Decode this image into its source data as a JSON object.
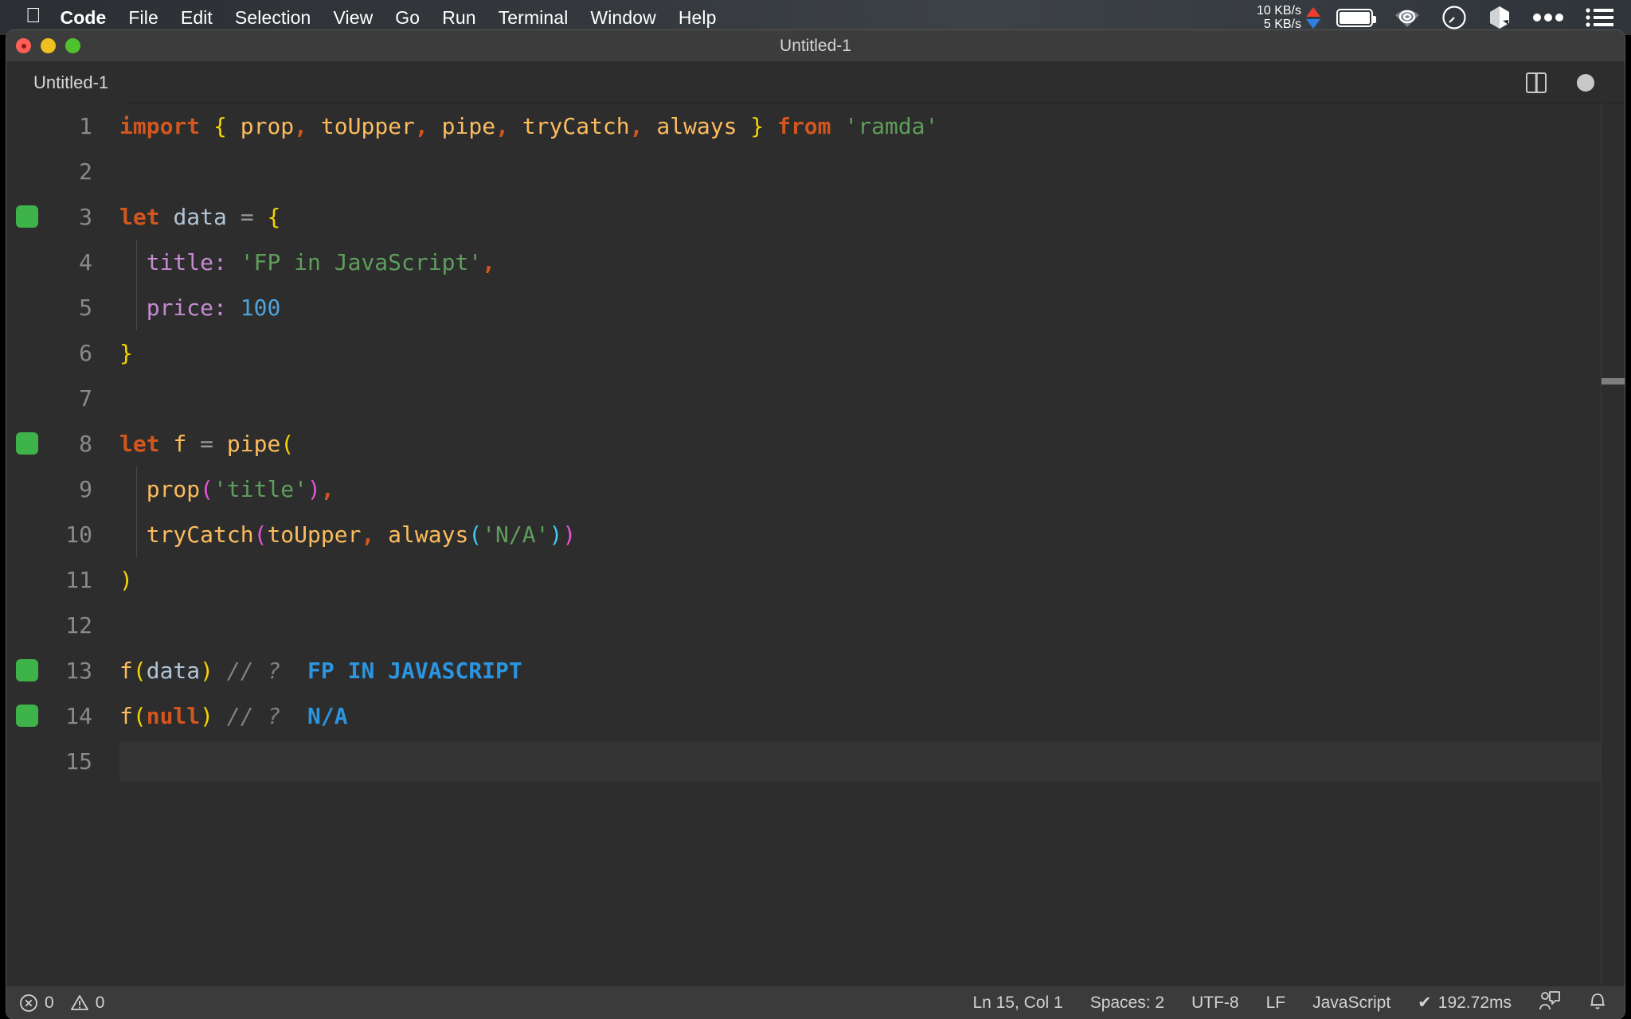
{
  "menubar": {
    "apple_icon": "apple-logo-icon",
    "items": [
      {
        "label": "Code",
        "bold": true
      },
      {
        "label": "File",
        "bold": false
      },
      {
        "label": "Edit",
        "bold": false
      },
      {
        "label": "Selection",
        "bold": false
      },
      {
        "label": "View",
        "bold": false
      },
      {
        "label": "Go",
        "bold": false
      },
      {
        "label": "Run",
        "bold": false
      },
      {
        "label": "Terminal",
        "bold": false
      },
      {
        "label": "Window",
        "bold": false
      },
      {
        "label": "Help",
        "bold": false
      }
    ],
    "network": {
      "upload": "10 KB/s",
      "download": "5 KB/s",
      "upload_color": "#ef3b2d",
      "download_color": "#2f7fe0"
    },
    "status_icons": [
      "battery-icon",
      "wifi-icon",
      "speedometer-icon",
      "box-icon",
      "ellipsis-icon",
      "list-icon"
    ]
  },
  "window": {
    "title": "Untitled-1"
  },
  "tabbar": {
    "tab_label": "Untitled-1",
    "actions": [
      "split-editor-icon",
      "unsaved-dot-icon"
    ]
  },
  "editor": {
    "language": "JavaScript",
    "active_line": 15,
    "lines": [
      {
        "n": "1",
        "badge": false,
        "indent": false
      },
      {
        "n": "2",
        "badge": false,
        "indent": false
      },
      {
        "n": "3",
        "badge": true,
        "indent": false
      },
      {
        "n": "4",
        "badge": false,
        "indent": true
      },
      {
        "n": "5",
        "badge": false,
        "indent": true
      },
      {
        "n": "6",
        "badge": false,
        "indent": false
      },
      {
        "n": "7",
        "badge": false,
        "indent": false
      },
      {
        "n": "8",
        "badge": true,
        "indent": false
      },
      {
        "n": "9",
        "badge": false,
        "indent": true
      },
      {
        "n": "10",
        "badge": false,
        "indent": true
      },
      {
        "n": "11",
        "badge": false,
        "indent": false
      },
      {
        "n": "12",
        "badge": false,
        "indent": false
      },
      {
        "n": "13",
        "badge": true,
        "indent": false
      },
      {
        "n": "14",
        "badge": true,
        "indent": false
      },
      {
        "n": "15",
        "badge": false,
        "indent": false
      }
    ],
    "code": {
      "l1": "import { prop, toUpper, pipe, tryCatch, always } from 'ramda'",
      "l2": "",
      "l3": "let data = {",
      "l4": "  title: 'FP in JavaScript',",
      "l5": "  price: 100",
      "l6": "}",
      "l7": "",
      "l8": "let f = pipe(",
      "l9": "  prop('title'),",
      "l10": "  tryCatch(toUpper, always('N/A'))",
      "l11": ")",
      "l12": "",
      "l13": "f(data) // ?  FP IN JAVASCRIPT",
      "l14": "f(null) // ?  N/A",
      "l15": ""
    },
    "tokens": {
      "t_import": "import",
      "t_brace_open": "{",
      "t_prop": "prop",
      "t_c1": ",",
      "t_toUpper": "toUpper",
      "t_c2": ",",
      "t_pipe": "pipe",
      "t_c3": ",",
      "t_tryCatch": "tryCatch",
      "t_c4": ",",
      "t_always": "always",
      "t_brace_close": "}",
      "t_from": "from",
      "t_ramda": "'ramda'",
      "t_let": "let",
      "t_data": "data",
      "t_eq": "=",
      "t_obj_open": "{",
      "t_title_key": "title:",
      "t_title_val": "'FP in JavaScript'",
      "t_comma": ",",
      "t_price_key": "price:",
      "t_price_val": "100",
      "t_obj_close": "}",
      "t_let2": "let",
      "t_f": "f",
      "t_eq2": "=",
      "t_pipe2": "pipe",
      "t_paren_open": "(",
      "t_prop2": "prop",
      "t_p_open": "(",
      "t_title_str": "'title'",
      "t_p_close": ")",
      "t_comma2": ",",
      "t_tryCatch2": "tryCatch",
      "t_tc_open": "(",
      "t_toUpper2": "toUpper",
      "t_comma3": ",",
      "t_always2": "always",
      "t_al_open": "(",
      "t_na_str": "'N/A'",
      "t_al_close": ")",
      "t_tc_close": ")",
      "t_paren_close": ")",
      "t_f2": "f",
      "t_fp_open": "(",
      "t_data2": "data",
      "t_fp_close": ")",
      "t_cmt1": "// ?",
      "t_out1": "FP IN JAVASCRIPT",
      "t_f3": "f",
      "t_fn_open": "(",
      "t_null": "null",
      "t_fn_close": ")",
      "t_cmt2": "// ?",
      "t_out2": "N/A"
    }
  },
  "statusbar": {
    "error_icon": "error-circle-icon",
    "error_count": "0",
    "warning_icon": "warning-triangle-icon",
    "warning_count": "0",
    "cursor_position": "Ln 15, Col 1",
    "indentation": "Spaces: 2",
    "encoding": "UTF-8",
    "eol": "LF",
    "language_mode": "JavaScript",
    "quokka_check": "✔",
    "quokka_time": "192.72ms",
    "feedback_icon": "feedback-person-icon",
    "bell_icon": "bell-icon"
  },
  "colors": {
    "editor_bg": "#2d2d2d",
    "titlebar_bg": "#3c3c3c",
    "statusbar_bg": "#3b3b3b",
    "keyword": "#d2561e",
    "function": "#fcbc5e",
    "string": "#5e9e5c",
    "number": "#4ea3dd",
    "property": "#c48bd1",
    "comment": "#808080",
    "bracket_yellow": "#f5d400",
    "bracket_magenta": "#e453d8",
    "bracket_cyan": "#45c8f0",
    "inline_output": "#2b95e0",
    "gutter_badge": "#3eb34a"
  }
}
